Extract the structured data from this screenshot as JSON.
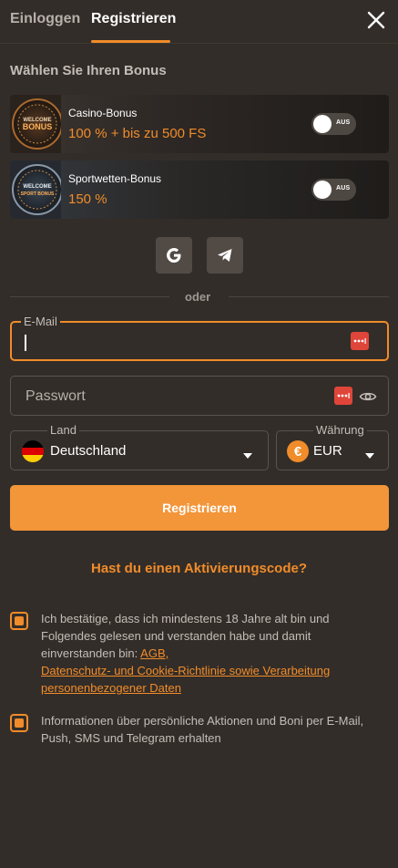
{
  "tabs": {
    "login": "Einloggen",
    "register": "Registrieren"
  },
  "section_title": "Wählen Sie Ihren Bonus",
  "bonuses": [
    {
      "name": "Casino-Bonus",
      "value": "100 % + bis zu 500 FS",
      "toggle": "AUS",
      "badge_top": "WELCOME",
      "badge_main": "BONUS"
    },
    {
      "name": "Sportwetten-Bonus",
      "value": "150 %",
      "toggle": "AUS",
      "badge_top": "WELCOME",
      "badge_main": "SPORT BONUS"
    }
  ],
  "divider": "oder",
  "email": {
    "label": "E-Mail",
    "value": ""
  },
  "password": {
    "placeholder": "Passwort"
  },
  "country": {
    "label": "Land",
    "value": "Deutschland"
  },
  "currency": {
    "label": "Währung",
    "value": "EUR",
    "symbol": "€"
  },
  "register_button": "Registrieren",
  "activation_code": "Hast du einen Aktivierungscode?",
  "consent": {
    "age_text": "Ich bestätige, dass ich mindestens 18 Jahre alt bin und Folgendes gelesen und verstanden habe und damit einverstanden bin:",
    "link_agb": "AGB,",
    "link_privacy": "Datenschutz- und Cookie-Richtlinie sowie Verarbeitung personenbezogener Daten",
    "marketing_text": "Informationen über persönliche Aktionen und Boni per E-Mail, Push, SMS und Telegram erhalten"
  },
  "colors": {
    "accent": "#f08c2a",
    "background": "#332d29",
    "button": "#f39539"
  }
}
